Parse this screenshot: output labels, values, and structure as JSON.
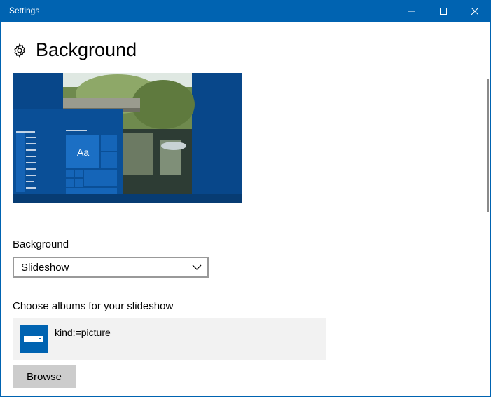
{
  "window": {
    "title": "Settings"
  },
  "header": {
    "title": "Background",
    "icon": "gear-icon"
  },
  "preview": {
    "tile_text": "Aa"
  },
  "background_section": {
    "label": "Background",
    "selected": "Slideshow"
  },
  "slideshow": {
    "label": "Choose albums for your slideshow",
    "album_name": "kind:=picture",
    "browse_label": "Browse"
  },
  "colors": {
    "accent": "#0063b1",
    "preview_bg": "#08478a",
    "album_bg": "#f2f2f2",
    "button_bg": "#cccccc"
  }
}
